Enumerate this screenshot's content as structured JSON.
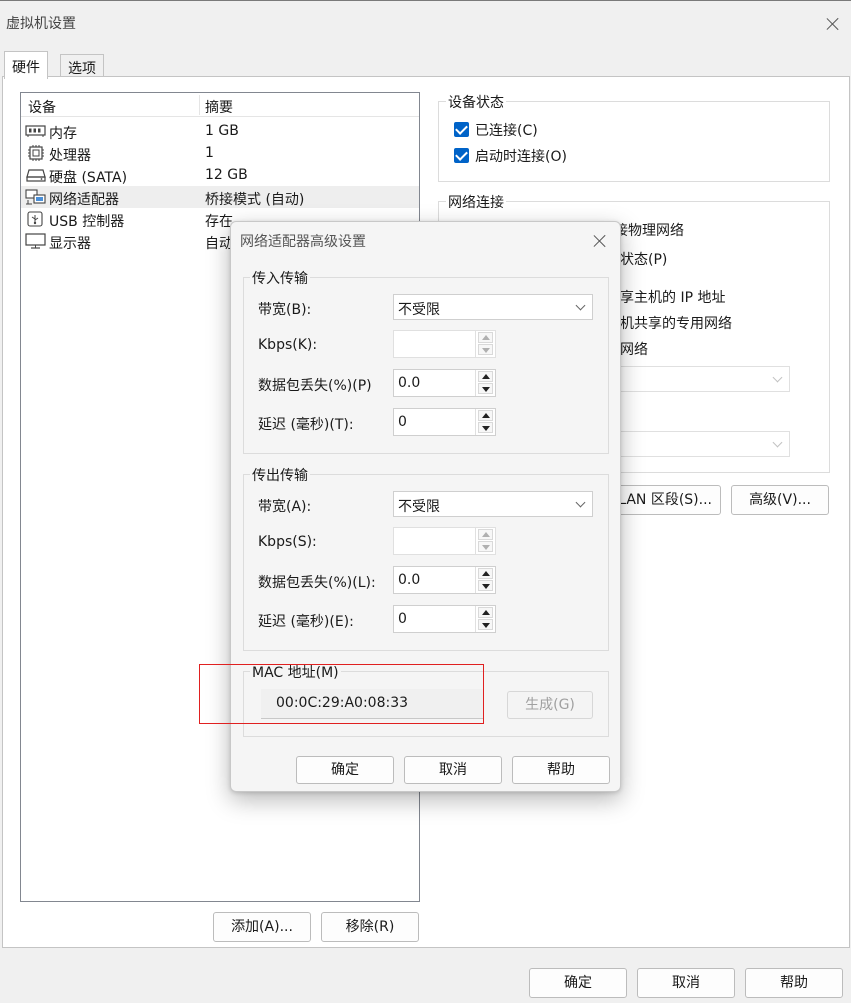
{
  "window": {
    "title": "虚拟机设置"
  },
  "tabs": [
    {
      "label": "硬件"
    },
    {
      "label": "选项"
    }
  ],
  "device_list": {
    "headers": {
      "device": "设备",
      "summary": "摘要"
    },
    "rows": [
      {
        "name": "内存",
        "summary": "1 GB",
        "icon": "memory-icon"
      },
      {
        "name": "处理器",
        "summary": "1",
        "icon": "cpu-icon"
      },
      {
        "name": "硬盘 (SATA)",
        "summary": "12 GB",
        "icon": "harddisk-icon"
      },
      {
        "name": "网络适配器",
        "summary": "桥接模式 (自动)",
        "icon": "network-adapter-icon",
        "selected": true
      },
      {
        "name": "USB 控制器",
        "summary": "存在",
        "icon": "usb-icon"
      },
      {
        "name": "显示器",
        "summary": "自动",
        "icon": "display-icon"
      }
    ],
    "add_label": "添加(A)...",
    "remove_label": "移除(R)"
  },
  "device_status": {
    "title": "设备状态",
    "connected": "已连接(C)",
    "connect_on_start": "启动时连接(O)"
  },
  "network": {
    "title": "网络连接",
    "partial_lines": [
      "接物理网络",
      "状态(P)",
      "享主机的 IP 地址",
      "机共享的专用网络",
      "网络"
    ],
    "lan_button": "LAN 区段(S)...",
    "advanced_button": "高级(V)..."
  },
  "dialog": {
    "title": "网络适配器高级设置",
    "incoming": {
      "title": "传入传输",
      "bandwidth_label": "带宽(B):",
      "bandwidth_value": "不受限",
      "kbps_label": "Kbps(K):",
      "kbps_value": "",
      "loss_label": "数据包丢失(%)(P)",
      "loss_value": "0.0",
      "latency_label": "延迟 (毫秒)(T):",
      "latency_value": "0"
    },
    "outgoing": {
      "title": "传出传输",
      "bandwidth_label": "带宽(A):",
      "bandwidth_value": "不受限",
      "kbps_label": "Kbps(S):",
      "kbps_value": "",
      "loss_label": "数据包丢失(%)(L):",
      "loss_value": "0.0",
      "latency_label": "延迟 (毫秒)(E):",
      "latency_value": "0"
    },
    "mac": {
      "label": "MAC 地址(M)",
      "value": "00:0C:29:A0:08:33",
      "generate": "生成(G)"
    },
    "ok": "确定",
    "cancel": "取消",
    "help": "帮助"
  },
  "footer": {
    "ok": "确定",
    "cancel": "取消",
    "help": "帮助"
  },
  "colors": {
    "checkbox": "#0063c8",
    "annotation": "#e02020"
  }
}
